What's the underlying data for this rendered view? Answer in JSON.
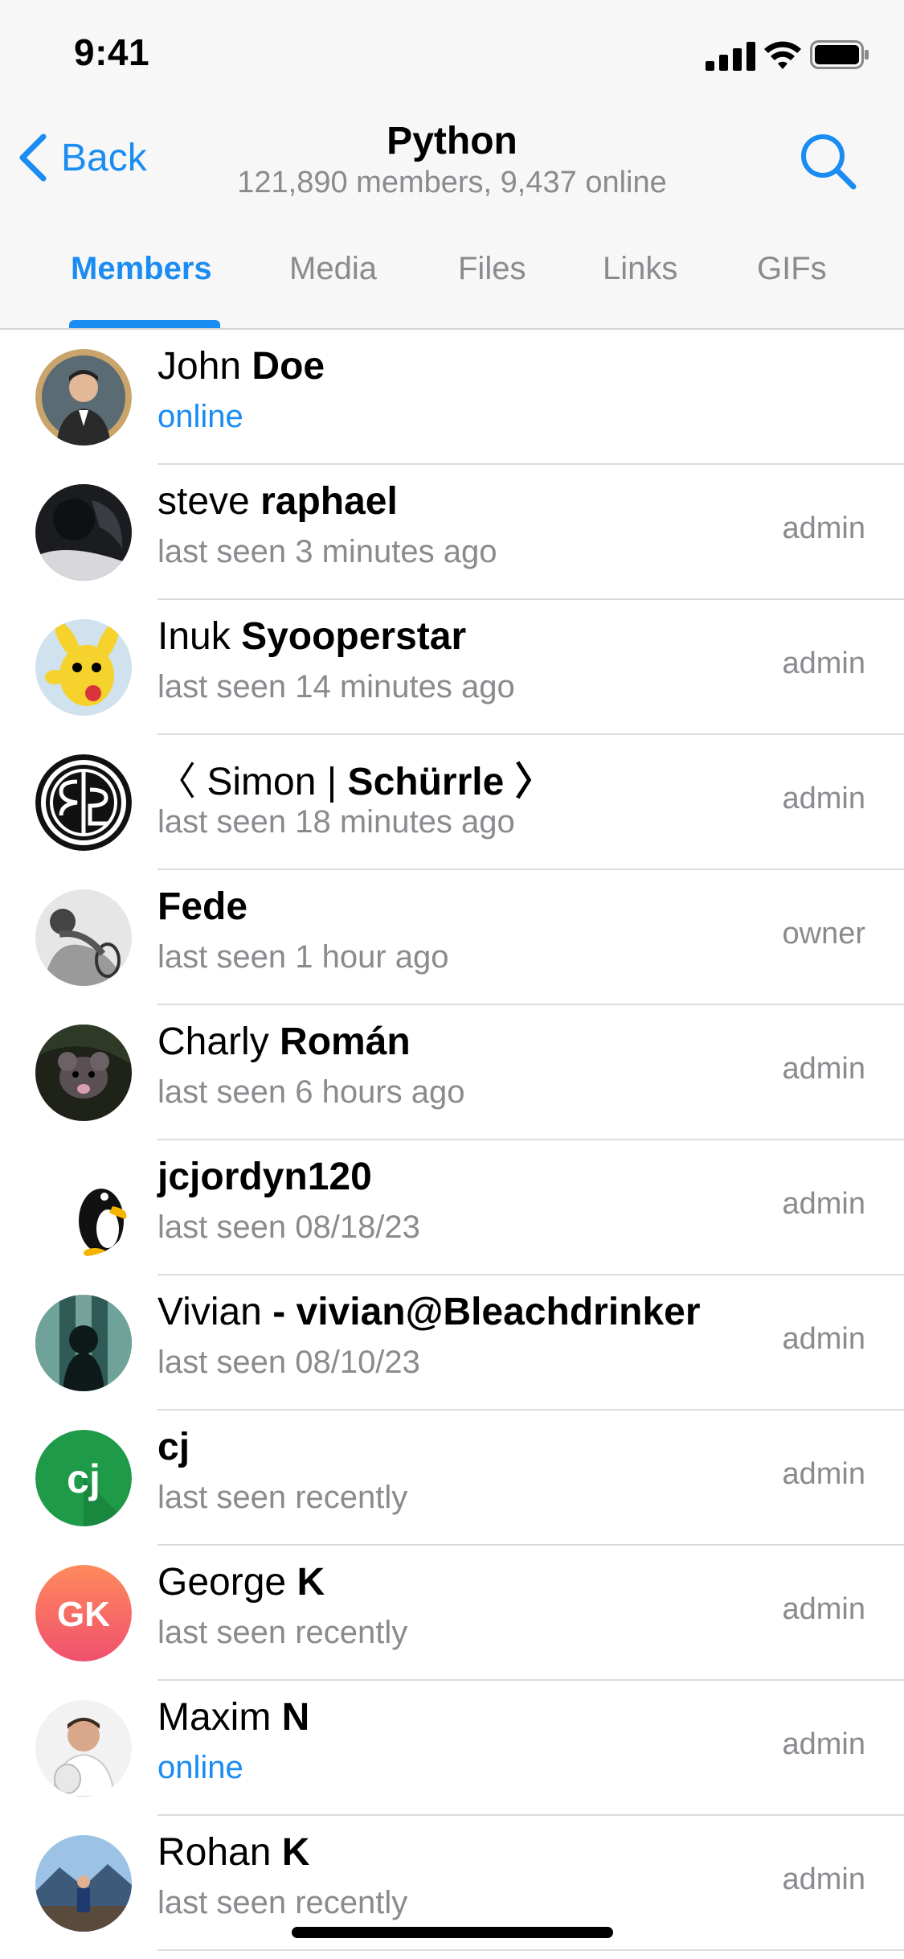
{
  "status_bar": {
    "time": "9:41"
  },
  "header": {
    "back_label": "Back",
    "title": "Python",
    "subtitle": "121,890 members, 9,437 online"
  },
  "tabs": [
    {
      "label": "Members",
      "active": true
    },
    {
      "label": "Media"
    },
    {
      "label": "Files"
    },
    {
      "label": "Links"
    },
    {
      "label": "GIFs"
    }
  ],
  "members": [
    {
      "first": "John ",
      "last": "Doe",
      "status": "online",
      "role": ""
    },
    {
      "first": "steve ",
      "last": "raphael",
      "status": "last seen 3 minutes ago",
      "role": "admin"
    },
    {
      "first": "Inuk ",
      "last": "Syooperstar",
      "status": "last seen 14 minutes ago",
      "role": "admin"
    },
    {
      "first": "〈 Simon | ",
      "last": "Schürrle 〉",
      "status": "last seen 18 minutes ago",
      "role": "admin"
    },
    {
      "first": "",
      "last": "Fede",
      "status": "last seen 1 hour ago",
      "role": "owner"
    },
    {
      "first": "Charly ",
      "last": "Román",
      "status": "last seen 6 hours ago",
      "role": "admin"
    },
    {
      "first": "",
      "last": "jcjordyn120",
      "status": "last seen 08/18/23",
      "role": "admin"
    },
    {
      "first": "Vivian ",
      "last": "- vivian@Bleachdrinker",
      "status": "last seen 08/10/23",
      "role": "admin"
    },
    {
      "first": "",
      "last": "cj",
      "status": "last seen recently",
      "role": "admin",
      "initials": "cj"
    },
    {
      "first": "George ",
      "last": "K",
      "status": "last seen recently",
      "role": "admin",
      "initials": "GK"
    },
    {
      "first": "Maxim ",
      "last": "N",
      "status": "online",
      "role": "admin"
    },
    {
      "first": "Rohan ",
      "last": "K",
      "status": "last seen recently",
      "role": "admin"
    }
  ],
  "colors": {
    "accent": "#1a8cf2",
    "secondary_text": "#8a8a8f"
  }
}
